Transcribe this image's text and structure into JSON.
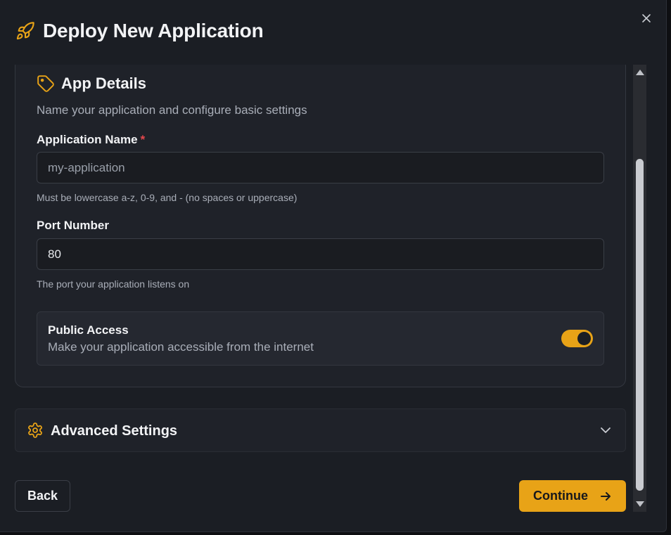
{
  "header": {
    "title": "Deploy New Application",
    "icon": "rocket-icon"
  },
  "colors": {
    "accent": "#e8a317",
    "required": "#e5484d",
    "background": "#1b1e24"
  },
  "section": {
    "title": "App Details",
    "icon": "tag-icon",
    "description": "Name your application and configure basic settings"
  },
  "fields": {
    "app_name": {
      "label": "Application Name",
      "required_marker": "*",
      "value": "",
      "placeholder": "my-application",
      "hint": "Must be lowercase a-z, 0-9, and - (no spaces or uppercase)"
    },
    "port": {
      "label": "Port Number",
      "value": "80",
      "hint": "The port your application listens on"
    }
  },
  "public_access": {
    "title": "Public Access",
    "description": "Make your application accessible from the internet",
    "enabled": true
  },
  "advanced": {
    "title": "Advanced Settings",
    "icon": "gear-icon",
    "expanded": false
  },
  "buttons": {
    "back": "Back",
    "continue": "Continue"
  }
}
